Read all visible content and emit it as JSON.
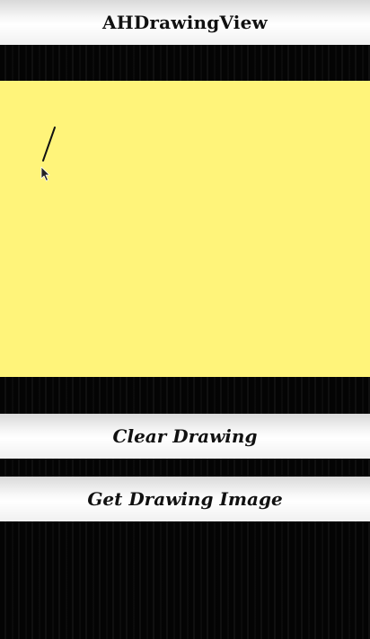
{
  "app": {
    "title": "AHDrawingView"
  },
  "buttons": {
    "clear_label": "Clear Drawing",
    "get_image_label": "Get Drawing Image"
  },
  "canvas": {
    "background_color": "#fff47a",
    "stroke_color": "#111111",
    "cursor_icon": "mouse-pointer-icon"
  }
}
